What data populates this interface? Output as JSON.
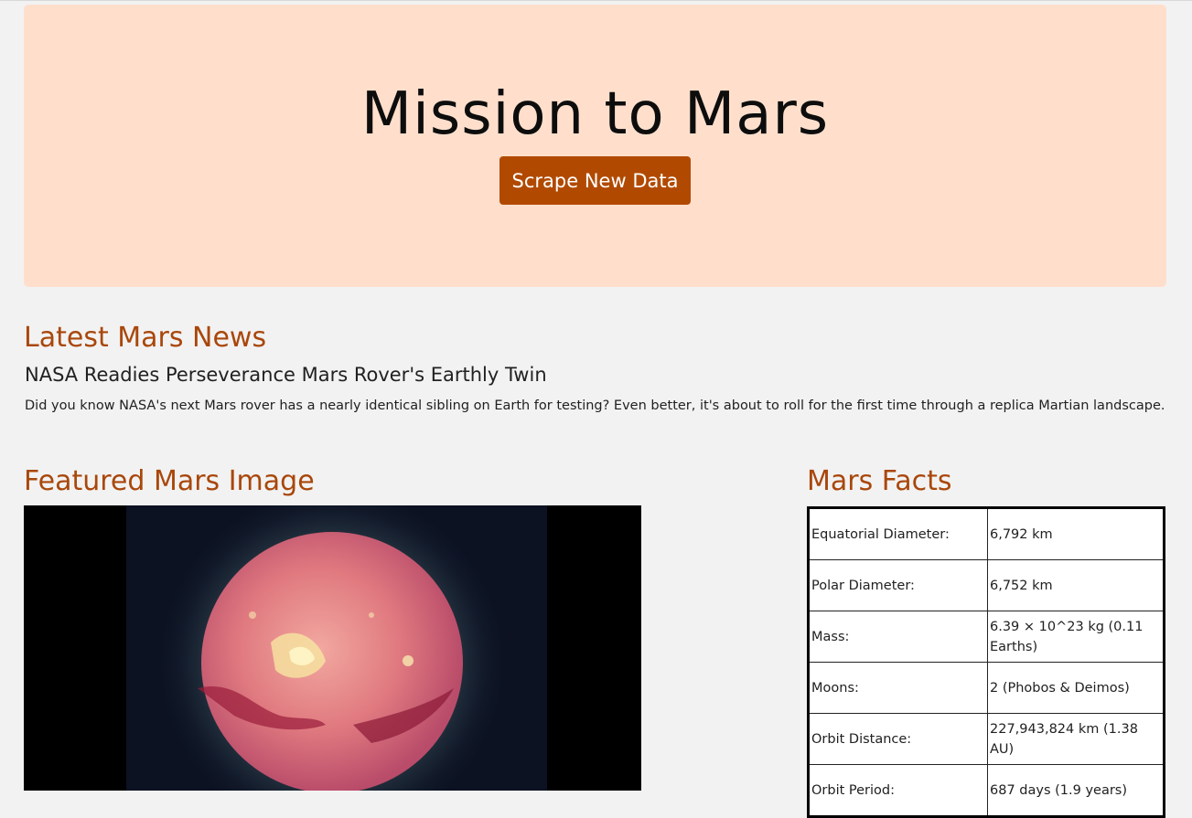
{
  "hero": {
    "title": "Mission to Mars",
    "button_label": "Scrape New Data"
  },
  "news": {
    "heading": "Latest Mars News",
    "title": "NASA Readies Perseverance Mars Rover's Earthly Twin",
    "paragraph": "Did you know NASA's next Mars rover has a nearly identical sibling on Earth for testing? Even better, it's about to roll for the first time through a replica Martian landscape."
  },
  "featured": {
    "heading": "Featured Mars Image"
  },
  "facts": {
    "heading": "Mars Facts",
    "rows": [
      {
        "label": "Equatorial Diameter:",
        "value": "6,792 km"
      },
      {
        "label": "Polar Diameter:",
        "value": "6,752 km"
      },
      {
        "label": "Mass:",
        "value": "6.39 × 10^23 kg (0.11 Earths)"
      },
      {
        "label": "Moons:",
        "value": "2 (Phobos & Deimos)"
      },
      {
        "label": "Orbit Distance:",
        "value": "227,943,824 km (1.38 AU)"
      },
      {
        "label": "Orbit Period:",
        "value": "687 days (1.9 years)"
      }
    ]
  },
  "colors": {
    "background": "#f2f2f2",
    "jumbotron": "#ffdfcc",
    "accent": "#a9470b",
    "button": "#b14a00"
  }
}
